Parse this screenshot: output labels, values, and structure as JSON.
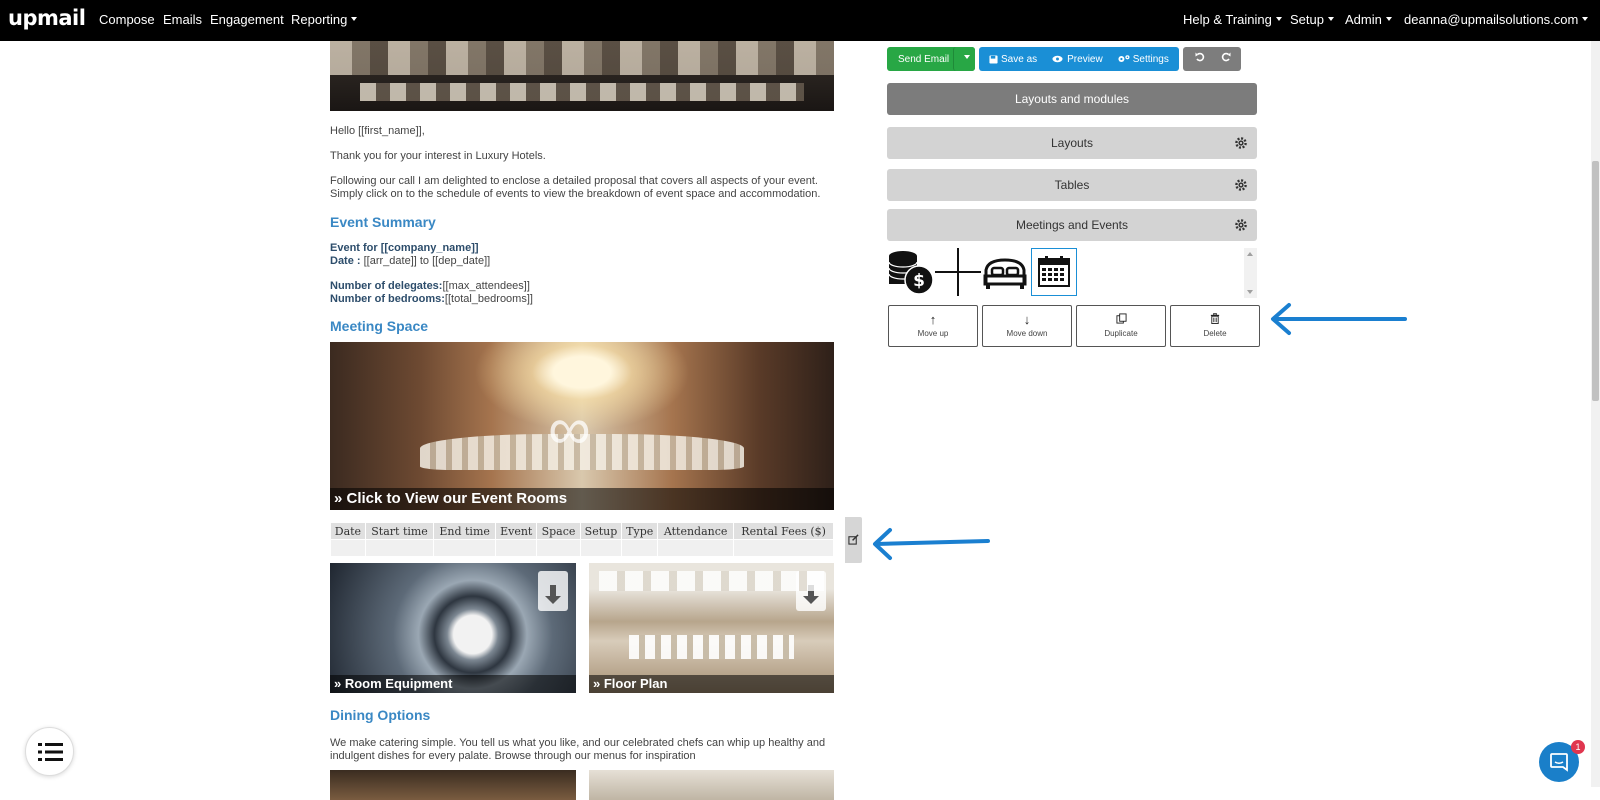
{
  "nav": {
    "logo": "upmail",
    "items": [
      "Compose",
      "Emails",
      "Engagement",
      "Reporting"
    ],
    "right": [
      "Help & Training",
      "Setup",
      "Admin",
      "deanna@upmailsolutions.com"
    ]
  },
  "email": {
    "greeting": "Hello [[first_name]],",
    "thanks": "Thank you for your interest in Luxury Hotels.",
    "following_1": "Following our call I am delighted to enclose a detailed proposal that covers all aspects of your event.",
    "following_2": "Simply click on to the schedule of events to view the breakdown of event space and accommodation.",
    "event_summary_heading": "Event Summary",
    "event_for_label": "Event for [[company_name]]",
    "date_label": "Date :",
    "date_value": " [[arr_date]] to [[dep_date]]",
    "delegates_label": "Number of delegates:",
    "delegates_value": "[[max_attendees]]",
    "bedrooms_label": "Number of bedrooms:",
    "bedrooms_value": "[[total_bedrooms]]",
    "meeting_space_heading": "Meeting Space",
    "event_rooms_caption": "» Click to View our Event Rooms",
    "schedule_headers": [
      "Date",
      "Start time",
      "End time",
      "Event",
      "Space",
      "Setup",
      "Type",
      "Attendance",
      "Rental Fees ($)"
    ],
    "room_equipment_caption": "» Room Equipment",
    "floor_plan_caption": "» Floor Plan",
    "dining_heading": "Dining Options",
    "dining_1": "We make catering simple. You tell us what you like, and our celebrated chefs can whip up healthy and",
    "dining_2": "indulgent dishes for every palate.  Browse through our menus for inspiration"
  },
  "toolbar": {
    "send_email": "Send Email",
    "save_as": "Save as",
    "preview": "Preview",
    "settings": "Settings"
  },
  "panel": {
    "title": "Layouts and modules",
    "sections": [
      "Layouts",
      "Tables",
      "Meetings and Events"
    ],
    "actions": [
      "Move up",
      "Move down",
      "Duplicate",
      "Delete"
    ]
  },
  "chat": {
    "badge": "1"
  },
  "colors": {
    "nav_bg": "#000000",
    "accent_blue": "#1a8fd6",
    "send_green": "#28a745",
    "heading_blue": "#3a88c4",
    "arrow_blue": "#1a7fd0"
  }
}
